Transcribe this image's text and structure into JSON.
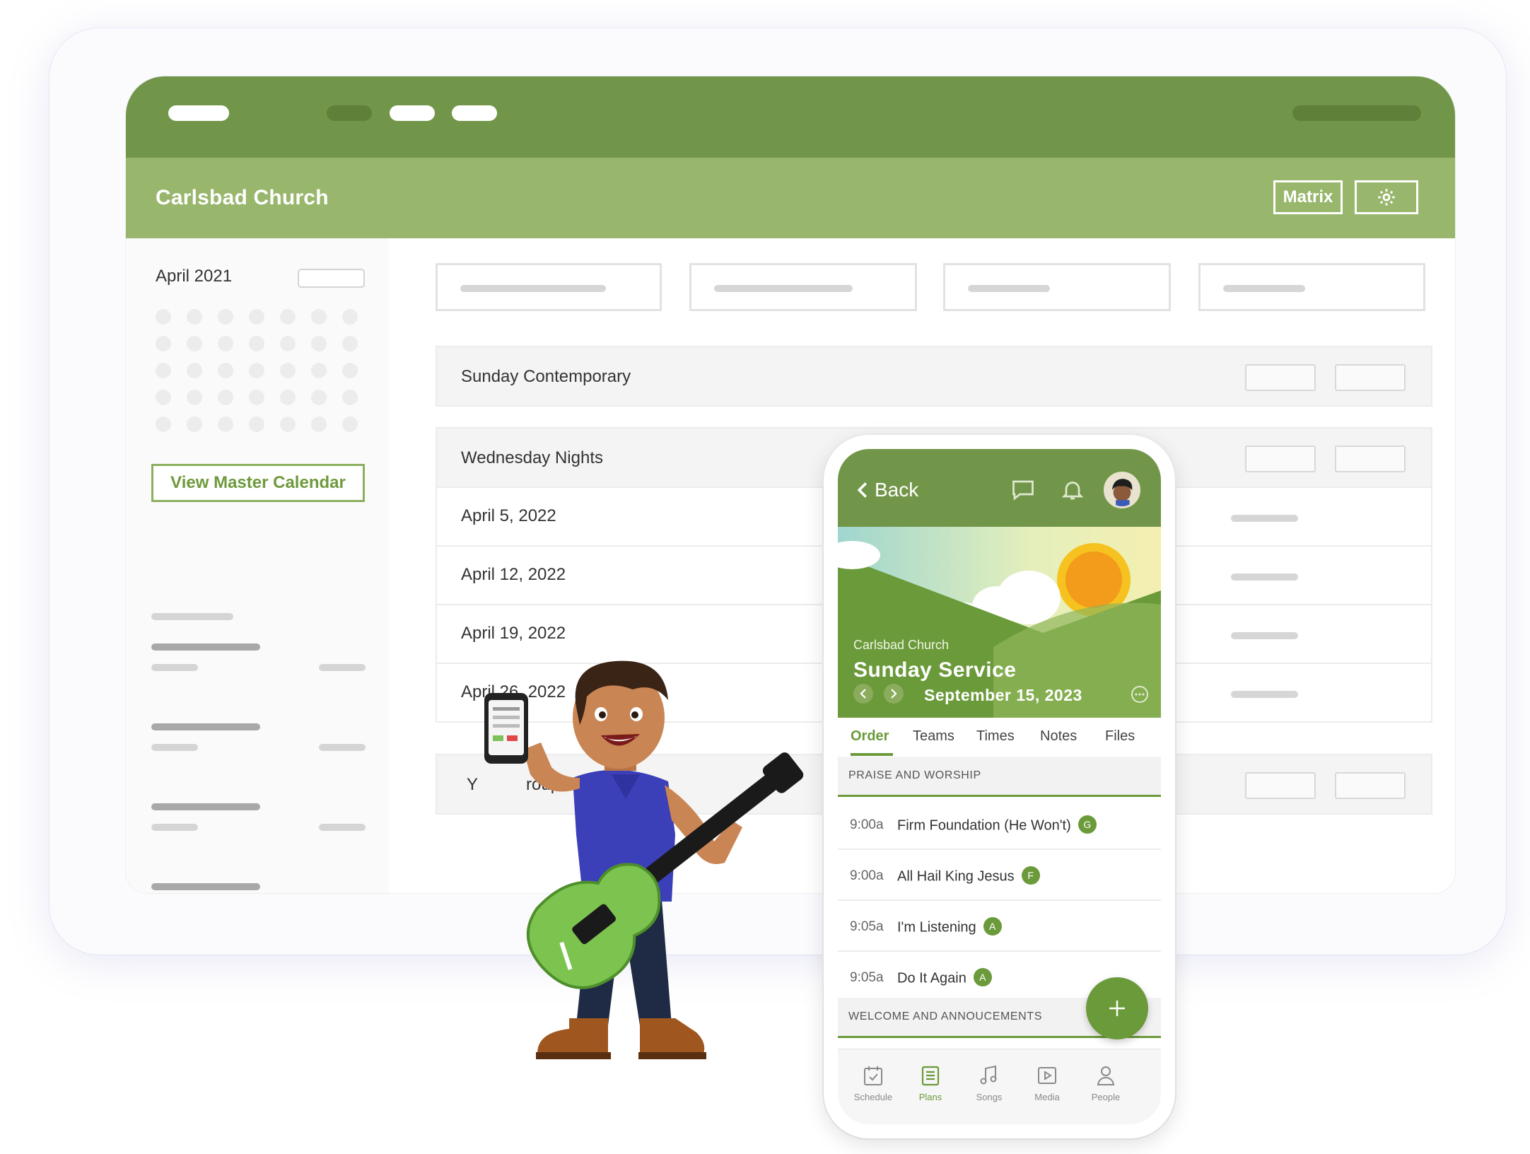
{
  "desktop": {
    "header": {
      "church_name": "Carlsbad Church",
      "matrix_button": "Matrix",
      "settings_icon": "gear-icon"
    },
    "sidebar": {
      "month": "April 2021",
      "master_calendar_button": "View Master Calendar"
    },
    "groups": [
      {
        "title": "Sunday Contemporary"
      },
      {
        "title": "Wednesday Nights",
        "dates": [
          "April 5, 2022",
          "April 12, 2022",
          "April 19, 2022",
          "April 26, 2022"
        ]
      },
      {
        "title_visible_part_1": "Y",
        "title_visible_part_2": "roup"
      }
    ]
  },
  "phone": {
    "header": {
      "back_label": "Back",
      "icons": [
        "chat-icon",
        "bell-icon",
        "avatar"
      ]
    },
    "hero": {
      "church": "Carlsbad Church",
      "title": "Sunday Service",
      "date": "September 15, 2023"
    },
    "tabs": [
      {
        "label": "Order",
        "active": true
      },
      {
        "label": "Teams"
      },
      {
        "label": "Times"
      },
      {
        "label": "Notes"
      },
      {
        "label": "Files"
      }
    ],
    "sections": [
      {
        "title": "PRAISE AND WORSHIP",
        "songs": [
          {
            "time": "9:00a",
            "title": "Firm Foundation (He Won't)",
            "key": "G"
          },
          {
            "time": "9:00a",
            "title": "All Hail King Jesus",
            "key": "F"
          },
          {
            "time": "9:05a",
            "title": "I'm Listening",
            "key": "A"
          },
          {
            "time": "9:05a",
            "title": "Do It Again",
            "key": "A"
          }
        ]
      },
      {
        "title": "WELCOME AND ANNOUCEMENTS"
      }
    ],
    "bottom_nav": [
      {
        "label": "Schedule",
        "icon": "calendar-check-icon"
      },
      {
        "label": "Plans",
        "icon": "list-icon",
        "active": true
      },
      {
        "label": "Songs",
        "icon": "music-note-icon"
      },
      {
        "label": "Media",
        "icon": "play-icon"
      },
      {
        "label": "People",
        "icon": "person-icon"
      }
    ]
  },
  "colors": {
    "brand_dark": "#729649",
    "brand_light": "#98b66c",
    "accent": "#6b9a3a"
  }
}
